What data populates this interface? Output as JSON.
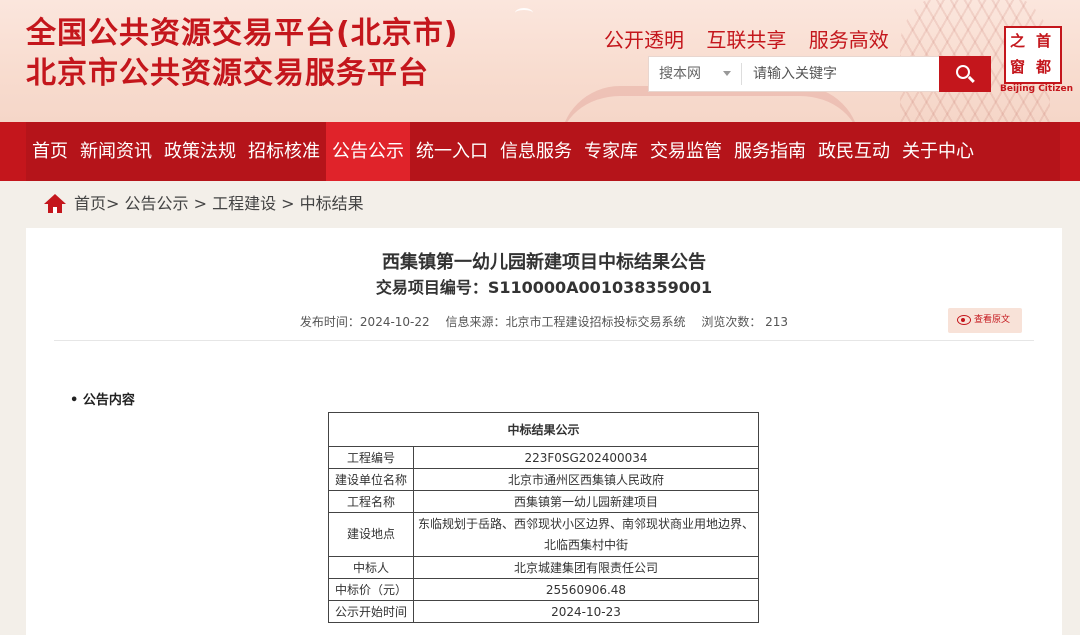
{
  "header": {
    "title_line1": "全国公共资源交易平台(北京市)",
    "title_line2": "北京市公共资源交易服务平台",
    "slogans": [
      "公开透明",
      "互联共享",
      "服务高效"
    ],
    "search": {
      "scope_label": "搜本网",
      "placeholder": "请输入关键字"
    },
    "logo": {
      "seal_chars": [
        "之",
        "首",
        "窗",
        "都"
      ],
      "caption": "Beijing Citizen"
    }
  },
  "nav": {
    "items": [
      "首页",
      "新闻资讯",
      "政策法规",
      "招标核准",
      "公告公示",
      "统一入口",
      "信息服务",
      "专家库",
      "交易监管",
      "服务指南",
      "政民互动",
      "关于中心"
    ],
    "active_index": 4
  },
  "breadcrumb": {
    "text": "首页> 公告公示 > 工程建设 > 中标结果"
  },
  "notice": {
    "title": "西集镇第一幼儿园新建项目中标结果公告",
    "project_code": "交易项目编号：S110000A001038359001",
    "publish_time": "发布时间：2024-10-22",
    "source": "信息来源：北京市工程建设招标投标交易系统",
    "views": "浏览次数：  213",
    "view_original_label": "查看原文",
    "section_label": "• 公告内容"
  },
  "result_table": {
    "title": "中标结果公示",
    "rows": [
      {
        "key": "工程编号",
        "value": "223F0SG202400034"
      },
      {
        "key": "建设单位名称",
        "value": "北京市通州区西集镇人民政府"
      },
      {
        "key": "工程名称",
        "value": "西集镇第一幼儿园新建项目"
      },
      {
        "key": "建设地点",
        "value": "东临规划于岳路、西邻现状小区边界、南邻现状商业用地边界、北临西集村中街"
      },
      {
        "key": "中标人",
        "value": "北京城建集团有限责任公司"
      },
      {
        "key": "中标价（元）",
        "value": "25560906.48"
      },
      {
        "key": "公示开始时间",
        "value": "2024-10-23"
      }
    ]
  },
  "colors": {
    "brand_red": "#c4161c",
    "nav_active": "#e0232a",
    "page_bg": "#f3efe9"
  }
}
